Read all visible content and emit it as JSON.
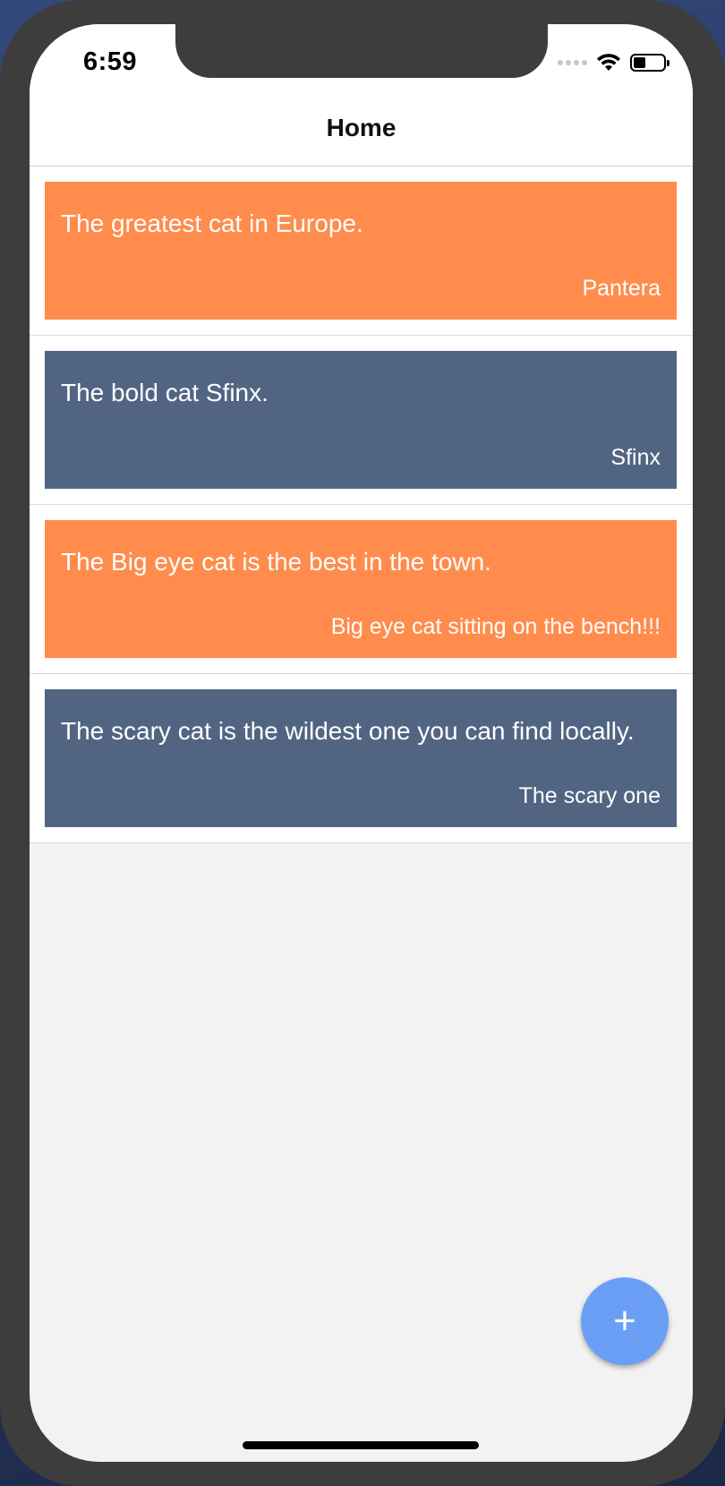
{
  "status_bar": {
    "time": "6:59",
    "signal_icon": "cellular-signal-icon",
    "wifi_icon": "wifi-icon",
    "battery_icon": "battery-icon",
    "battery_level": 0.35
  },
  "header": {
    "title": "Home"
  },
  "colors": {
    "orange_card": "#ff8c4c",
    "blue_card": "#516583",
    "fab": "#6a9ff5",
    "background": "#f2f2f2"
  },
  "cards": [
    {
      "text": "The greatest cat in Europe.",
      "author": "Pantera",
      "color": "orange"
    },
    {
      "text": "The bold cat Sfinx.",
      "author": "Sfinx",
      "color": "blue"
    },
    {
      "text": "The Big eye cat is the best in the town.",
      "author": "Big eye cat sitting on the bench!!!",
      "color": "orange"
    },
    {
      "text": "The scary cat is the wildest one you can find locally.",
      "author": "The scary one",
      "color": "blue"
    }
  ],
  "fab": {
    "label": "+",
    "icon": "plus-icon"
  }
}
